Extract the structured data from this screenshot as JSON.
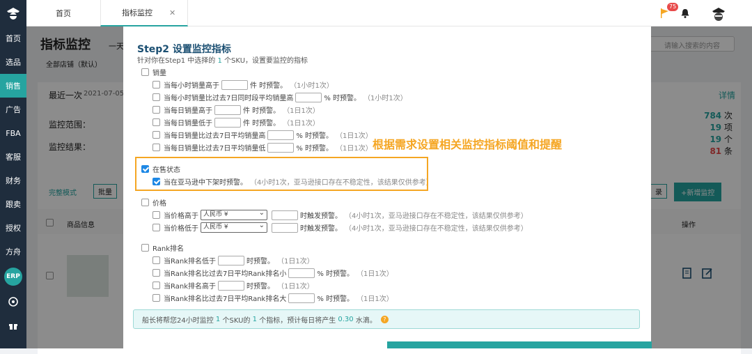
{
  "sidebar": {
    "items": [
      "首页",
      "选品",
      "销售",
      "广告",
      "FBA",
      "客服",
      "财务",
      "跟卖",
      "授权",
      "方舟"
    ],
    "erp": "ERP"
  },
  "topbar": {
    "tabs": [
      {
        "label": "首页"
      },
      {
        "label": "指标监控"
      }
    ],
    "notification_count": "75"
  },
  "background": {
    "page_title": "指标监控",
    "page_title_suffix": "一天",
    "search_placeholder": "请输入搜索的内容",
    "store_filter": "全部店铺（默认）",
    "recent": "最近一次",
    "recent_date": "2021-07-05",
    "detail_link": "详情",
    "scope_label": "监控范围：",
    "result_label": "监控结果：",
    "stats": [
      {
        "num": "784",
        "unit": "次"
      },
      {
        "num": "19",
        "unit": "项"
      },
      {
        "num": "19",
        "unit": "个"
      },
      {
        "num": "81",
        "unit": "条"
      }
    ],
    "full_mode": "完整模式",
    "batch": "批量",
    "add_monitor": "+新增监控",
    "record": "录",
    "col_product": "商品信息",
    "col_action": "操作"
  },
  "modal": {
    "title": "Step2 设置监控指标",
    "subtitle_pre": "针对你在Step1 中选择的",
    "subtitle_count": "1",
    "subtitle_post": "个SKU，设置要监控的指标",
    "sales": {
      "label": "销量",
      "rows": [
        {
          "pre": "当每小时销量高于",
          "post": "件 时预警。",
          "note": "（1小时1次）"
        },
        {
          "pre": "当每小时销量比过去7日同时段平均销量高",
          "post": "% 时预警。",
          "note": "（1小时1次）"
        },
        {
          "pre": "当每日销量高于",
          "post": "件 时预警。",
          "note": "（1日1次）"
        },
        {
          "pre": "当每日销量低于",
          "post": "件 时预警。",
          "note": "（1日1次）"
        },
        {
          "pre": "当每日销量比过去7日平均销量高",
          "post": "% 时预警。",
          "note": "（1日1次）"
        },
        {
          "pre": "当每日销量比过去7日平均销量低",
          "post": "% 时预警。",
          "note": "（1日1次）"
        }
      ]
    },
    "status": {
      "label": "在售状态",
      "row": {
        "text": "当在亚马逊中下架时预警。",
        "note": "（4小时1次，亚马逊接口存在不稳定性，该结果仅供参考）"
      }
    },
    "price": {
      "label": "价格",
      "rows": [
        {
          "pre": "当价格高于",
          "currency": "人民币 ¥",
          "post": "时触发预警。",
          "note": "（4小时1次，亚马逊接口存在不稳定性，该结果仅供参考）"
        },
        {
          "pre": "当价格低于",
          "currency": "人民币 ¥",
          "post": "时触发预警。",
          "note": "（4小时1次，亚马逊接口存在不稳定性，该结果仅供参考）"
        }
      ]
    },
    "rank": {
      "label": "Rank排名",
      "rows": [
        {
          "pre": "当Rank排名低于",
          "post": "时预警。",
          "note": "（1日1次）"
        },
        {
          "pre": "当Rank排名比过去7日平均Rank排名小",
          "post": "% 时预警。",
          "note": "（1日1次）"
        },
        {
          "pre": "当Rank排名高于",
          "post": "时预警。",
          "note": "（1日1次）"
        },
        {
          "pre": "当Rank排名比过去7日平均Rank排名大",
          "post": "% 时预警。",
          "note": "（1日1次）"
        }
      ]
    },
    "footer": {
      "t1": "船长将帮您24小时监控",
      "n1": "1",
      "t2": "个SKU的",
      "n2": "1",
      "t3": "个指标，预计每日将产生",
      "n3": "0.30",
      "t4": "水滴。"
    }
  },
  "annotation": "根据需求设置相关监控指标阈值和提醒"
}
